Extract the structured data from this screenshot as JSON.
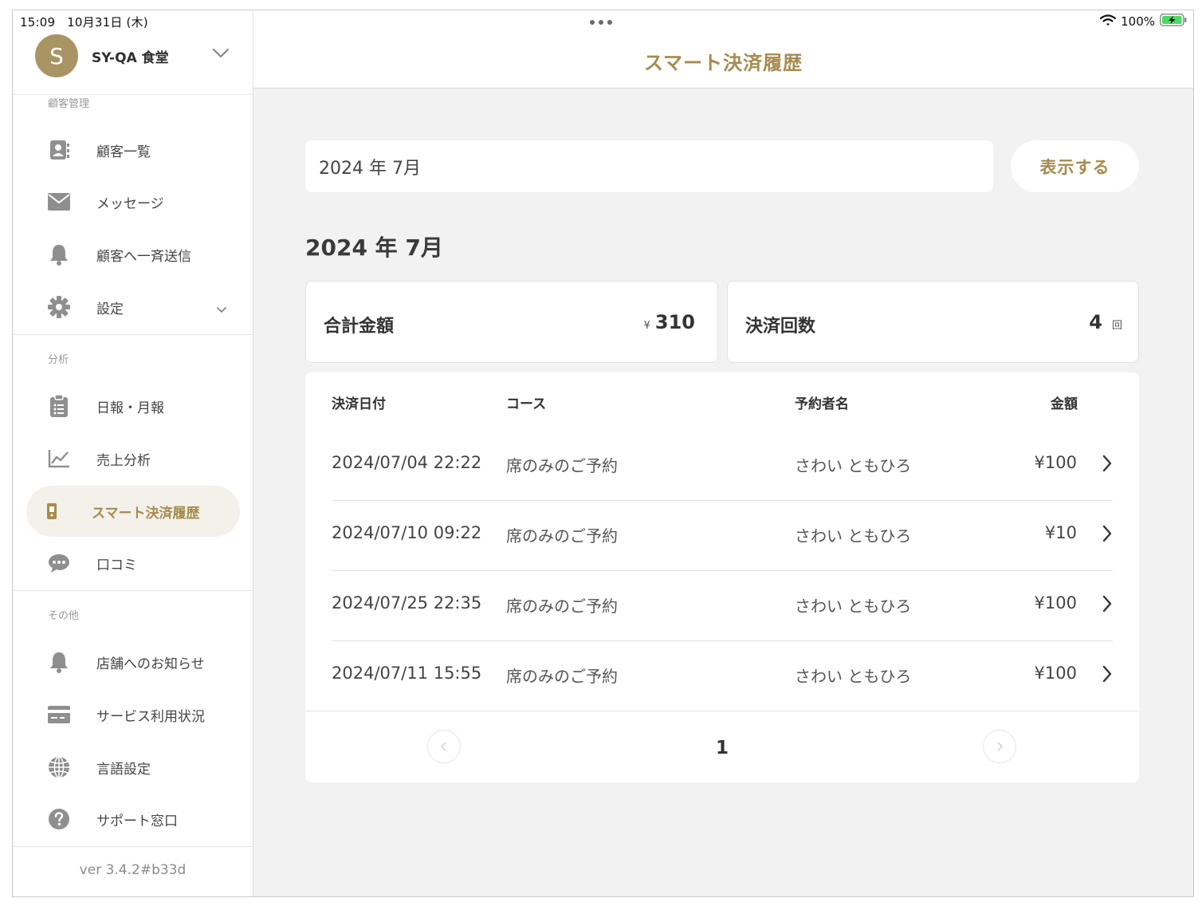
{
  "status_bar": {
    "time": "15:09",
    "date": "10月31日 (木)",
    "battery": "100%"
  },
  "sidebar": {
    "store_initial": "S",
    "store_name": "SY-QA 食堂",
    "sections": {
      "customer": "顧客管理",
      "analysis": "分析",
      "other": "その他"
    },
    "items": [
      {
        "label": "顧客一覧",
        "icon": "contact-book-icon"
      },
      {
        "label": "メッセージ",
        "icon": "envelope-icon"
      },
      {
        "label": "顧客へ一斉送信",
        "icon": "bell-icon"
      },
      {
        "label": "設定",
        "icon": "gear-icon"
      },
      {
        "label": "日報・月報",
        "icon": "clipboard-icon"
      },
      {
        "label": "売上分析",
        "icon": "line-chart-icon"
      },
      {
        "label": "スマート決済履歴",
        "icon": "smartphone-payment-icon"
      },
      {
        "label": "口コミ",
        "icon": "speech-bubble-icon"
      },
      {
        "label": "店舗へのお知らせ",
        "icon": "bell-icon"
      },
      {
        "label": "サービス利用状況",
        "icon": "credit-card-icon"
      },
      {
        "label": "言語設定",
        "icon": "globe-icon"
      },
      {
        "label": "サポート窓口",
        "icon": "question-circle-icon"
      }
    ],
    "version": "ver 3.4.2#b33d"
  },
  "header": {
    "title": "スマート決済履歴"
  },
  "filter": {
    "month_value": "2024 年 7月",
    "show_button": "表示する"
  },
  "month_heading": "2024 年 7月",
  "summary": {
    "total_label": "合計金額",
    "total_currency": "¥",
    "total_value": "310",
    "count_label": "決済回数",
    "count_value": "4",
    "count_unit": "回"
  },
  "table": {
    "columns": [
      "決済日付",
      "コース",
      "予約者名",
      "金額"
    ],
    "rows": [
      {
        "date": "2024/07/04 22:22",
        "course": "席のみのご予約",
        "name": "さわい ともひろ",
        "amount": "¥100"
      },
      {
        "date": "2024/07/10 09:22",
        "course": "席のみのご予約",
        "name": "さわい ともひろ",
        "amount": "¥10"
      },
      {
        "date": "2024/07/25 22:35",
        "course": "席のみのご予約",
        "name": "さわい ともひろ",
        "amount": "¥100"
      },
      {
        "date": "2024/07/11 15:55",
        "course": "席のみのご予約",
        "name": "さわい ともひろ",
        "amount": "¥100"
      }
    ],
    "page": "1"
  },
  "colors": {
    "accent": "#a68b4f",
    "avatar": "#a99463",
    "active_bg": "#f4f1ea",
    "background": "#f2f2f2"
  }
}
